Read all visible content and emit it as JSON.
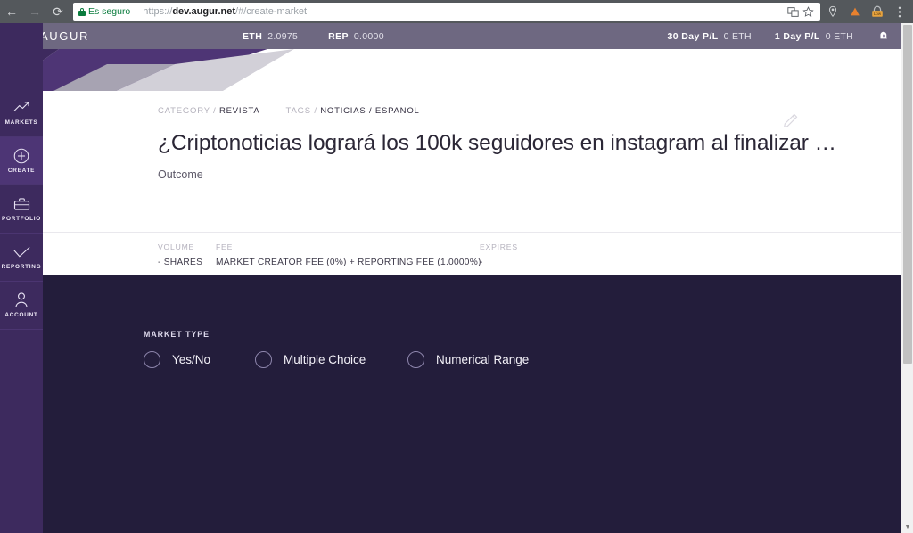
{
  "browser": {
    "back_icon": "back-arrow-icon",
    "forward_icon": "forward-arrow-icon",
    "reload_icon": "reload-icon",
    "security_label": "Es seguro",
    "url_scheme": "https://",
    "url_host": "dev.augur.net",
    "url_path": "/#/create-market",
    "url_full": "https://dev.augur.net/#/create-market",
    "omnibox_icons": [
      "translate-icon",
      "bookmark-star-icon"
    ],
    "toolbar_icons": [
      "location-pin-icon",
      "extension-triangle-icon",
      "lastpass-icon",
      "menu-kebab-icon"
    ]
  },
  "header": {
    "brand": "AUGUR",
    "logo_icon": "augur-diamond-logo",
    "eth_label": "ETH",
    "eth_value": "2.0975",
    "rep_label": "REP",
    "rep_value": "0.0000",
    "pl30_label": "30 Day P/L",
    "pl30_value": "0 ETH",
    "pl1_label": "1 Day P/L",
    "pl1_value": "0 ETH",
    "notification_icon": "bell-icon",
    "bar_color": "#6e6881",
    "brand_color": "#3d2a5e"
  },
  "sidebar": {
    "items": [
      {
        "label": "MARKETS",
        "icon": "trending-up-icon",
        "active": false
      },
      {
        "label": "CREATE",
        "icon": "plus-circle-icon",
        "active": true
      },
      {
        "label": "PORTFOLIO",
        "icon": "briefcase-icon",
        "active": false
      },
      {
        "label": "REPORTING",
        "icon": "check-icon",
        "active": false
      },
      {
        "label": "ACCOUNT",
        "icon": "person-icon",
        "active": false
      }
    ]
  },
  "market": {
    "category_label": "CATEGORY",
    "category_value": "REVISTA",
    "tags_label": "TAGS",
    "tags_value": "NOTICIAS / ESPANOL",
    "edit_icon": "pencil-edit-icon",
    "headline": "¿Criptonoticias logrará los 100k seguidores en instagram al finalizar …",
    "outcome_label": "Outcome",
    "stats": [
      {
        "label": "VOLUME",
        "value": "- SHARES"
      },
      {
        "label": "FEE",
        "value": "MARKET CREATOR FEE (0%) + REPORTING FEE (1.0000%)"
      },
      {
        "label": "EXPIRES",
        "value": "-"
      }
    ]
  },
  "market_type": {
    "label": "MARKET TYPE",
    "options": [
      {
        "label": "Yes/No",
        "selected": false
      },
      {
        "label": "Multiple Choice",
        "selected": false
      },
      {
        "label": "Numerical Range",
        "selected": false
      }
    ],
    "panel_color": "#231d3b"
  },
  "scrollbar": {
    "up_glyph": "▲",
    "down_glyph": "▼"
  }
}
